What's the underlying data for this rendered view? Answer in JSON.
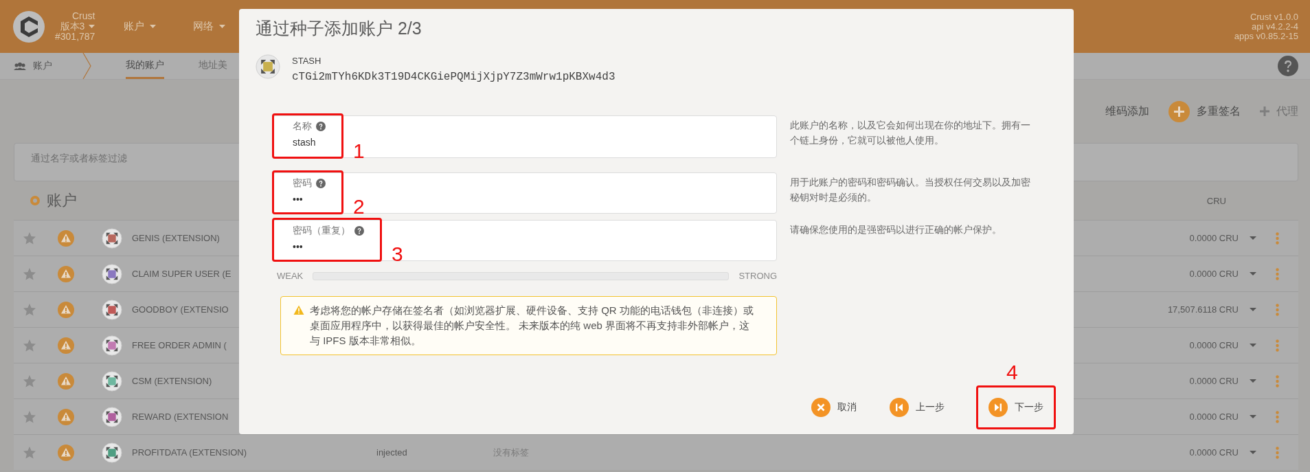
{
  "header": {
    "chain": {
      "name": "Crust",
      "version": "版本3",
      "block": "#301,787"
    },
    "menus": [
      {
        "label": "账户"
      },
      {
        "label": "网络"
      }
    ],
    "versions": [
      "Crust v1.0.0",
      "api v4.2.2-4",
      "apps v0.85.2-15"
    ]
  },
  "subnav": {
    "section": "账户",
    "tabs": [
      {
        "label": "我的账户",
        "selected": true
      },
      {
        "label": "地址美",
        "selected": false
      }
    ]
  },
  "toolbar": {
    "buttons": [
      {
        "label": "维码添加",
        "kind": "text",
        "disabled": false
      },
      {
        "label": "多重签名",
        "kind": "add",
        "disabled": false
      },
      {
        "label": "代理",
        "kind": "add",
        "disabled": true
      }
    ]
  },
  "filter": {
    "placeholder": "通过名字或者标签过滤"
  },
  "accounts": {
    "title": "账户",
    "balance_column": "CRU",
    "rows": [
      {
        "name": "GENIS (EXTENSION)",
        "color": "#b8685e",
        "balance": "0.0000",
        "unit": "CRU"
      },
      {
        "name": "CLAIM SUPER USER (E",
        "color": "#8a78c0",
        "balance": "0.0000",
        "unit": "CRU"
      },
      {
        "name": "GOODBOY (EXTENSIO",
        "color": "#c05a58",
        "balance": "17,507.6118",
        "unit": "CRU"
      },
      {
        "name": "FREE ORDER ADMIN (",
        "color": "#c27ab2",
        "balance": "0.0000",
        "unit": "CRU"
      },
      {
        "name": "CSM (EXTENSION)",
        "color": "#6fb8a0",
        "balance": "0.0000",
        "unit": "CRU"
      },
      {
        "name": "REWARD (EXTENSION",
        "color": "#b0609e",
        "balance": "0.0000",
        "unit": "CRU"
      },
      {
        "name": "PROFITDATA (EXTENSION)",
        "color": "#4e9e82",
        "type": "injected",
        "tags": "没有标签",
        "balance": "0.0000",
        "unit": "CRU"
      }
    ]
  },
  "dialog": {
    "title": "通过种子添加账户 2/3",
    "account": {
      "name": "STASH",
      "address": "cTGi2mTYh6KDk3T19D4CKGiePQMijXjpY7Z3mWrw1pKBXw4d3",
      "color": "#c8b04e"
    },
    "fields": [
      {
        "label": "名称",
        "value": "stash",
        "annotation": "1"
      },
      {
        "label": "密码",
        "value": "•••",
        "annotation": "2"
      },
      {
        "label": "密码（重复）",
        "value": "•••",
        "annotation": "3"
      }
    ],
    "help": [
      "此账户的名称，以及它会如何出现在你的地址下。拥有一个链上身份，它就可以被他人使用。",
      "用于此账户的密码和密码确认。当授权任何交易以及加密秘钥对时是必须的。",
      "请确保您使用的是强密码以进行正确的帐户保护。"
    ],
    "strength": {
      "weak": "WEAK",
      "strong": "STRONG",
      "level": 0
    },
    "warning": "考虑将您的帐户存储在签名者（如浏览器扩展、硬件设备、支持 QR 功能的电话钱包（非连接）或桌面应用程序中，以获得最佳的帐户安全性。 未来版本的纯 web 界面将不再支持非外部帐户，这与 IPFS 版本非常相似。",
    "buttons": [
      {
        "label": "取消",
        "kind": "cancel"
      },
      {
        "label": "上一步",
        "kind": "prev"
      },
      {
        "label": "下一步",
        "kind": "next",
        "annotation": "4"
      }
    ]
  }
}
